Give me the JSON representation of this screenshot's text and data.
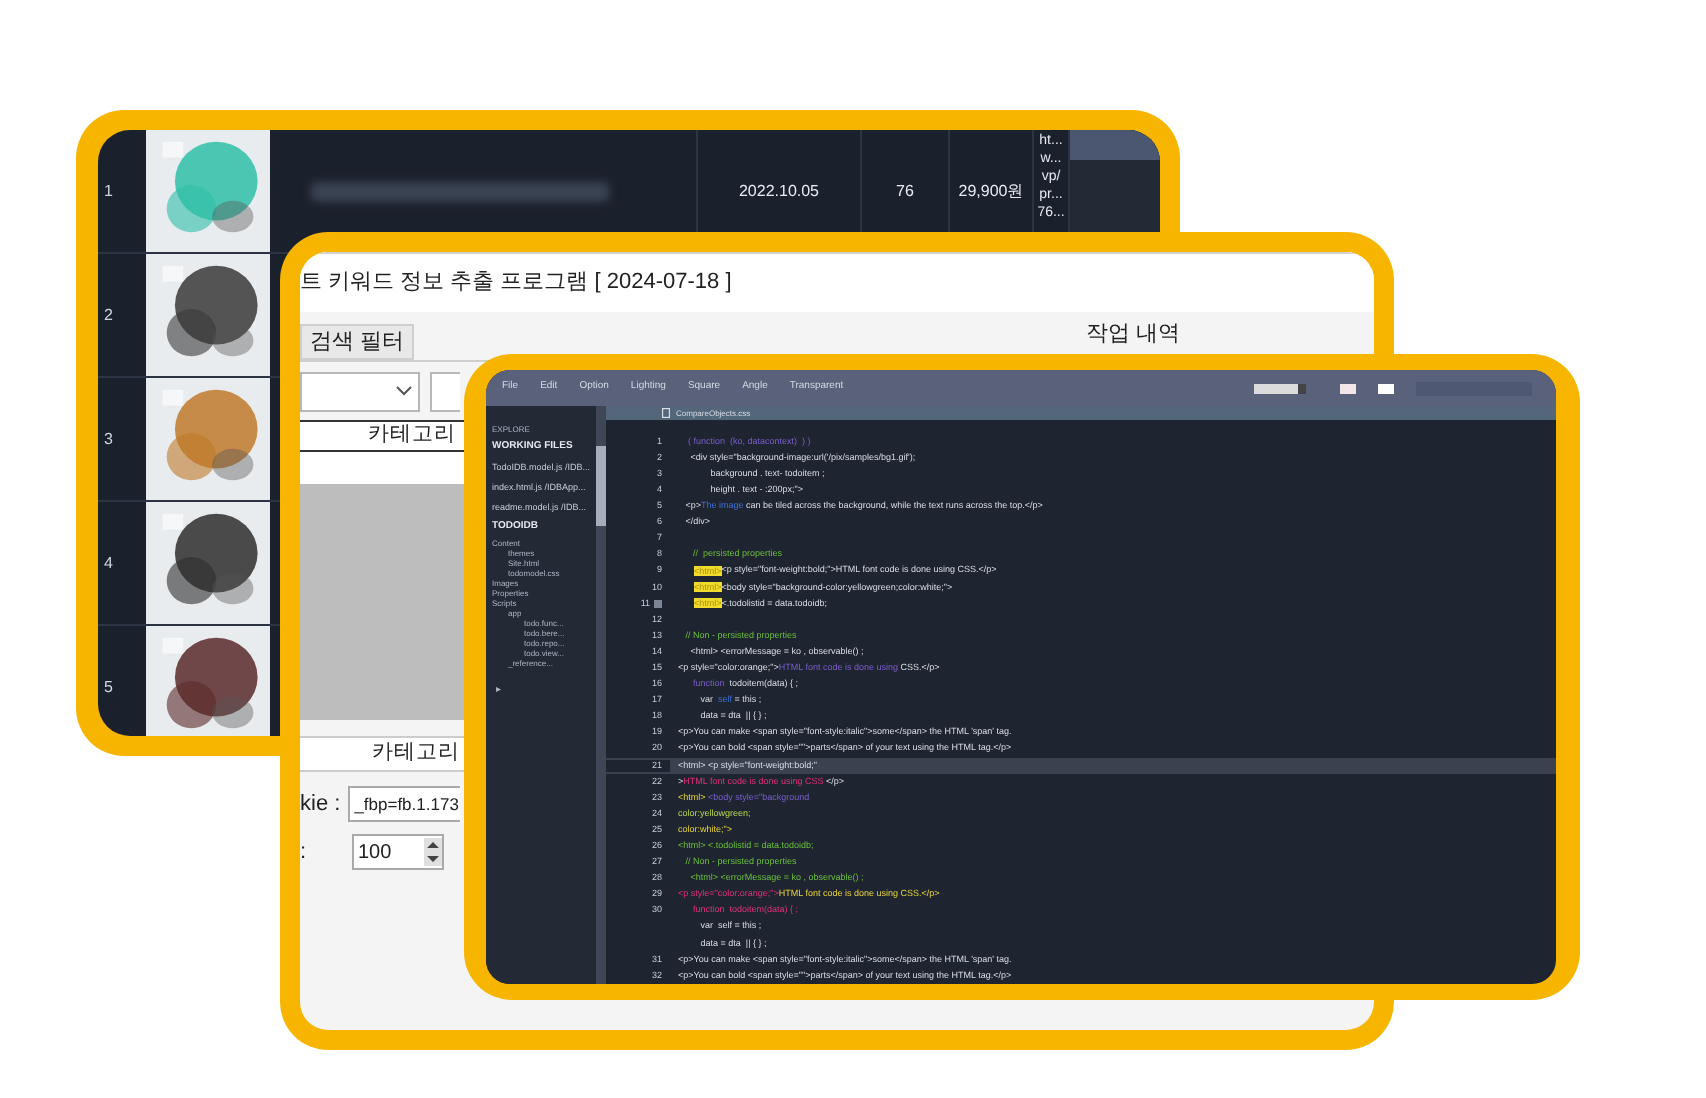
{
  "product_table": {
    "rows": [
      {
        "number": "1",
        "date": "2022.10.05",
        "count": "76",
        "price": "29,900원",
        "url": [
          "ht...",
          "w...",
          "vp/",
          "pr...",
          "76..."
        ]
      },
      {
        "number": "2"
      },
      {
        "number": "3"
      },
      {
        "number": "4"
      },
      {
        "number": "5"
      }
    ]
  },
  "keyword_program": {
    "title": "트 키워드 정보 추출 프로그램 [ 2024-07-18 ]",
    "tab": "검색 필터",
    "side_title": "작업 내역",
    "category_header": "카테고리",
    "category_footer": "카테고리",
    "cookie_label": "kie :",
    "cookie_value": "_fbp=fb.1.173",
    "count_label": ":",
    "count_value": "100"
  },
  "code_editor": {
    "menu": [
      "File",
      "Edit",
      "Option",
      "Lighting",
      "Square",
      "Angle",
      "Transparent"
    ],
    "zoom_slider": {
      "level": 0.85
    },
    "file_tab": "CompareObjects.css",
    "explorer_label": "EXPLORE",
    "working_files": {
      "title": "WORKING FILES",
      "files": [
        "TodoIDB.model.js  /IDB...",
        "index.html.js  /IDBApp...",
        "readme.model.js  /IDB..."
      ]
    },
    "project": {
      "title": "TODOIDB",
      "tree": [
        {
          "label": "Content",
          "children": [
            {
              "label": "themes"
            },
            {
              "label": "Site.html"
            },
            {
              "label": "todomodel.css"
            }
          ]
        },
        {
          "label": "Images"
        },
        {
          "label": "Properties"
        },
        {
          "label": "Scripts",
          "children": [
            {
              "label": "app",
              "children": [
                {
                  "label": "todo.func..."
                },
                {
                  "label": "todo.bere..."
                },
                {
                  "label": "todo.repo..."
                },
                {
                  "label": "todo.view..."
                }
              ]
            },
            {
              "label": "_reference..."
            }
          ]
        }
      ]
    },
    "collapse_glyph": "▸",
    "lines": [
      {
        "num": "1",
        "segs": [
          {
            "t": "    ( function  (ko, datacontext)  ) )",
            "kind": "keyword"
          }
        ]
      },
      {
        "num": "2",
        "segs": [
          {
            "t": "     <div style=\"background-image:url('/pix/samples/bg1.gif');",
            "kind": "plain"
          }
        ]
      },
      {
        "num": "3",
        "segs": [
          {
            "t": "             background . text- todoitem ;",
            "kind": "plain"
          }
        ]
      },
      {
        "num": "4",
        "segs": [
          {
            "t": "             height . text - :200px;\">",
            "kind": "plain"
          }
        ]
      },
      {
        "num": "5",
        "segs": [
          {
            "t": "   <p>",
            "kind": "plain"
          },
          {
            "t": "The image",
            "kind": "variable"
          },
          {
            "t": " can be tiled across the background, while the text runs across the top.</p>",
            "kind": "plain"
          }
        ]
      },
      {
        "num": "6",
        "segs": [
          {
            "t": "   </div>",
            "kind": "plain"
          }
        ]
      },
      {
        "num": "7"
      },
      {
        "num": "8",
        "segs": [
          {
            "t": "      //  persisted properties",
            "kind": "comment"
          }
        ]
      },
      {
        "num": "9",
        "tag": "<html>",
        "segs": [
          {
            "t": "<p style=\"font-weight:bold;\">HTML font code is done using CSS.</p>",
            "kind": "plain"
          }
        ]
      },
      {
        "num": "10",
        "tag": "<html>",
        "segs": [
          {
            "t": "<body style=\"background-color:yellowgreen;color:white;\">",
            "kind": "plain"
          }
        ]
      },
      {
        "num": "11",
        "tag": "<html>",
        "marker": true,
        "segs": [
          {
            "t": "<.todolistid = data.todoidb;",
            "kind": "plain"
          }
        ]
      },
      {
        "num": "12"
      },
      {
        "num": "13",
        "segs": [
          {
            "t": "   // Non - persisted properties",
            "kind": "comment"
          }
        ]
      },
      {
        "num": "14",
        "segs": [
          {
            "t": "     <html> <errorMessage = ko , observable() ;",
            "kind": "plain"
          }
        ]
      },
      {
        "num": "15",
        "segs": [
          {
            "t": "<p style=\"color:orange;\">",
            "kind": "plain"
          },
          {
            "t": "HTML font code is done using",
            "kind": "keyword"
          },
          {
            "t": " CSS.</p>",
            "kind": "plain"
          }
        ]
      },
      {
        "num": "16",
        "segs": [
          {
            "t": "      function",
            "kind": "keyword"
          },
          {
            "t": "  todoitem(data) { ;",
            "kind": "plain"
          }
        ]
      },
      {
        "num": "17",
        "segs": [
          {
            "t": "         var  ",
            "kind": "plain"
          },
          {
            "t": "self",
            "kind": "variable"
          },
          {
            "t": " = this ;",
            "kind": "plain"
          }
        ]
      },
      {
        "num": "18",
        "segs": [
          {
            "t": "         data = dta  || { } ;",
            "kind": "plain"
          }
        ]
      },
      {
        "num": "19",
        "segs": [
          {
            "t": "<p>You can make <span style=\"font-style:italic\">some</span> the HTML 'span' tag.",
            "kind": "plain"
          }
        ]
      },
      {
        "num": "20",
        "segs": [
          {
            "t": "<p>You can bold <span style=\"\">parts</span> of your text using the HTML tag.</p>",
            "kind": "plain"
          }
        ]
      },
      {
        "num": "21",
        "current": true,
        "segs": [
          {
            "t": "<html> <p style=\"font-weight:bold;\"",
            "kind": "plain"
          }
        ]
      },
      {
        "num": "22",
        "segs": [
          {
            "t": ">",
            "kind": "plain"
          },
          {
            "t": "HTML font code is done using CSS",
            "kind": "accent"
          },
          {
            "t": " </p>",
            "kind": "plain"
          }
        ]
      },
      {
        "num": "23",
        "segs": [
          {
            "t": "<html>",
            "kind": "attribute"
          },
          {
            "t": " <body style=\"background",
            "kind": "keyword"
          }
        ]
      },
      {
        "num": "24",
        "segs": [
          {
            "t": "color:yellowgreen;",
            "kind": "value"
          }
        ]
      },
      {
        "num": "25",
        "segs": [
          {
            "t": "color:white;\">",
            "kind": "attribute"
          }
        ]
      },
      {
        "num": "26",
        "segs": [
          {
            "t": "<html> <.todolistid = data.todoidb;",
            "kind": "comment"
          }
        ]
      },
      {
        "num": "27",
        "segs": [
          {
            "t": "   // Non - persisted properties",
            "kind": "comment"
          }
        ]
      },
      {
        "num": "28",
        "segs": [
          {
            "t": "     <html> <errorMessage = ko , observable() ;",
            "kind": "comment"
          }
        ]
      },
      {
        "num": "29",
        "segs": [
          {
            "t": "<p style=\"color:orange;\">",
            "kind": "accent"
          },
          {
            "t": "HTML font code is done using CSS.</p>",
            "kind": "attribute"
          }
        ]
      },
      {
        "num": "30",
        "segs": [
          {
            "t": "      function  todoitem(data) { ;",
            "kind": "accent"
          }
        ]
      },
      {
        "segs": [
          {
            "t": "         var  self = this ;",
            "kind": "plain"
          }
        ]
      },
      {
        "segs": [
          {
            "t": "         data = dta  || { } ;",
            "kind": "plain"
          }
        ]
      },
      {
        "num": "31",
        "segs": [
          {
            "t": "<p>You can make <span style=\"font-style:italic\">some</span> the HTML 'span' tag.",
            "kind": "plain"
          }
        ]
      },
      {
        "num": "32",
        "segs": [
          {
            "t": "<p>You can bold <span style=\"\">parts</span> of your text using the HTML tag.</p>",
            "kind": "plain"
          }
        ]
      }
    ]
  }
}
